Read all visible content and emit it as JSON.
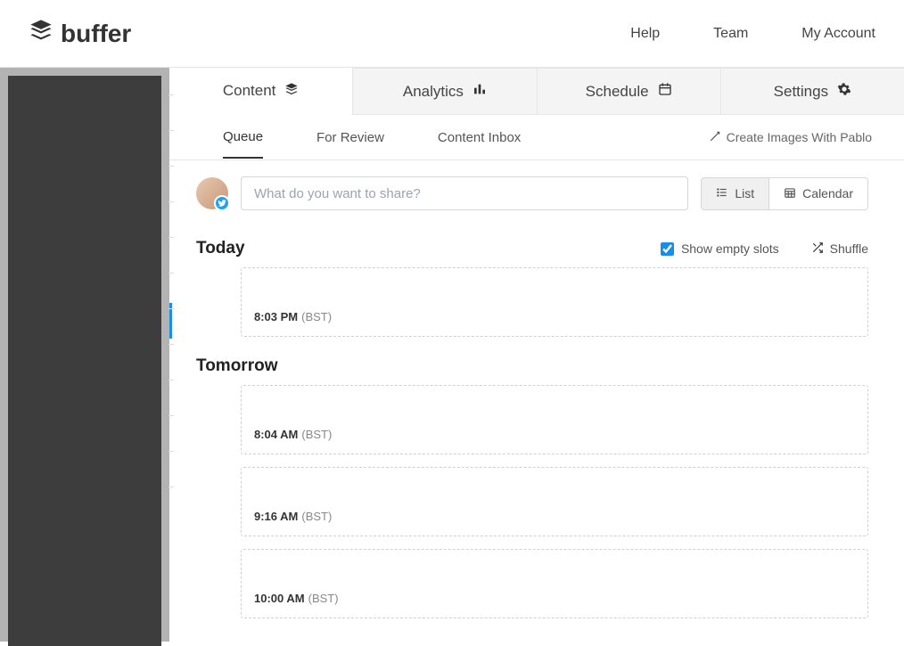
{
  "header": {
    "brand": "buffer",
    "nav": {
      "help": "Help",
      "team": "Team",
      "account": "My Account"
    }
  },
  "tabs": {
    "content": "Content",
    "analytics": "Analytics",
    "schedule": "Schedule",
    "settings": "Settings"
  },
  "subtabs": {
    "queue": "Queue",
    "for_review": "For Review",
    "content_inbox": "Content Inbox",
    "pablo": "Create Images With Pablo"
  },
  "composer": {
    "placeholder": "What do you want to share?",
    "list": "List",
    "calendar": "Calendar"
  },
  "queue": {
    "show_empty_label": "Show empty slots",
    "shuffle_label": "Shuffle",
    "days": [
      {
        "title": "Today",
        "show_controls": true,
        "slots": [
          {
            "time": "8:03 PM",
            "tz": "(BST)"
          }
        ]
      },
      {
        "title": "Tomorrow",
        "show_controls": false,
        "slots": [
          {
            "time": "8:04 AM",
            "tz": "(BST)"
          },
          {
            "time": "9:16 AM",
            "tz": "(BST)"
          },
          {
            "time": "10:00 AM",
            "tz": "(BST)"
          }
        ]
      }
    ]
  }
}
